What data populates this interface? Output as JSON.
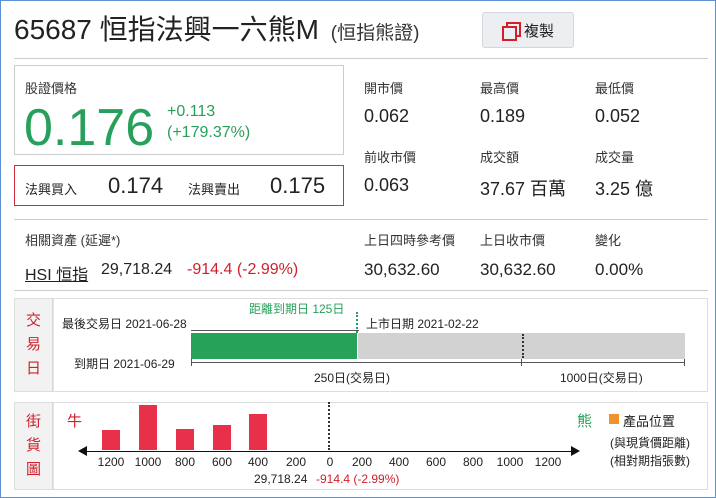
{
  "header": {
    "code": "65687",
    "name": "恒指法興一六熊M",
    "underlying_paren": "(恒指熊證)",
    "copy_label": "複製"
  },
  "price": {
    "label": "股證價格",
    "value": "0.176",
    "change": "+0.113",
    "change_pct": "(+179.37%)"
  },
  "bid_ask": {
    "bid_label": "法興買入",
    "bid_value": "0.174",
    "ask_label": "法興賣出",
    "ask_value": "0.175"
  },
  "stats": {
    "open_label": "開市價",
    "open_value": "0.062",
    "high_label": "最高價",
    "high_value": "0.189",
    "low_label": "最低價",
    "low_value": "0.052",
    "prev_close_label": "前收市價",
    "prev_close_value": "0.063",
    "turnover_label": "成交額",
    "turnover_value": "37.67 百萬",
    "volume_label": "成交量",
    "volume_value": "3.25 億"
  },
  "related": {
    "label": "相關資產 (延遲*)",
    "asset_name": "HSI 恒指",
    "asset_value": "29,718.24",
    "asset_change": "-914.4 (-2.99%)",
    "ref_label": "上日四時參考價",
    "ref_value": "30,632.60",
    "close_label": "上日收市價",
    "close_value": "30,632.60",
    "change_label": "變化",
    "change_value": "0.00%"
  },
  "trade_days": {
    "side_chars": [
      "交",
      "易",
      "日"
    ],
    "last_trade": "最後交易日 2021-06-28",
    "days_to_expiry": "距離到期日 125日",
    "listing_date": "上市日期 2021-02-22",
    "expiry_date": "到期日 2021-06-29",
    "scale_250": "250日(交易日)",
    "scale_1000": "1000日(交易日)",
    "progress_fraction": 0.336
  },
  "street_chart": {
    "side_chars": [
      "街",
      "貨",
      "圖"
    ],
    "bull_label": "牛",
    "bear_label": "熊",
    "legend_label": "產品位置",
    "note1": "(與現貨價距離)",
    "note2": "(相對期指張數)",
    "ticks": [
      "1200",
      "1000",
      "800",
      "600",
      "400",
      "200",
      "0",
      "200",
      "400",
      "600",
      "800",
      "1000",
      "1200"
    ],
    "current_value": "29,718.24",
    "current_change": "-914.4 (-2.99%)",
    "colors": {
      "bull": "#e8304a",
      "bear": "#26a05a",
      "legend": "#f0912a"
    }
  },
  "chart_data": {
    "type": "bar",
    "categories": [
      "1200",
      "1000",
      "800",
      "600",
      "400"
    ],
    "series": [
      {
        "values": [
          2,
          4.5,
          2.1,
          2.5,
          3.6
        ]
      }
    ],
    "xlabel": "",
    "ylabel": ""
  }
}
